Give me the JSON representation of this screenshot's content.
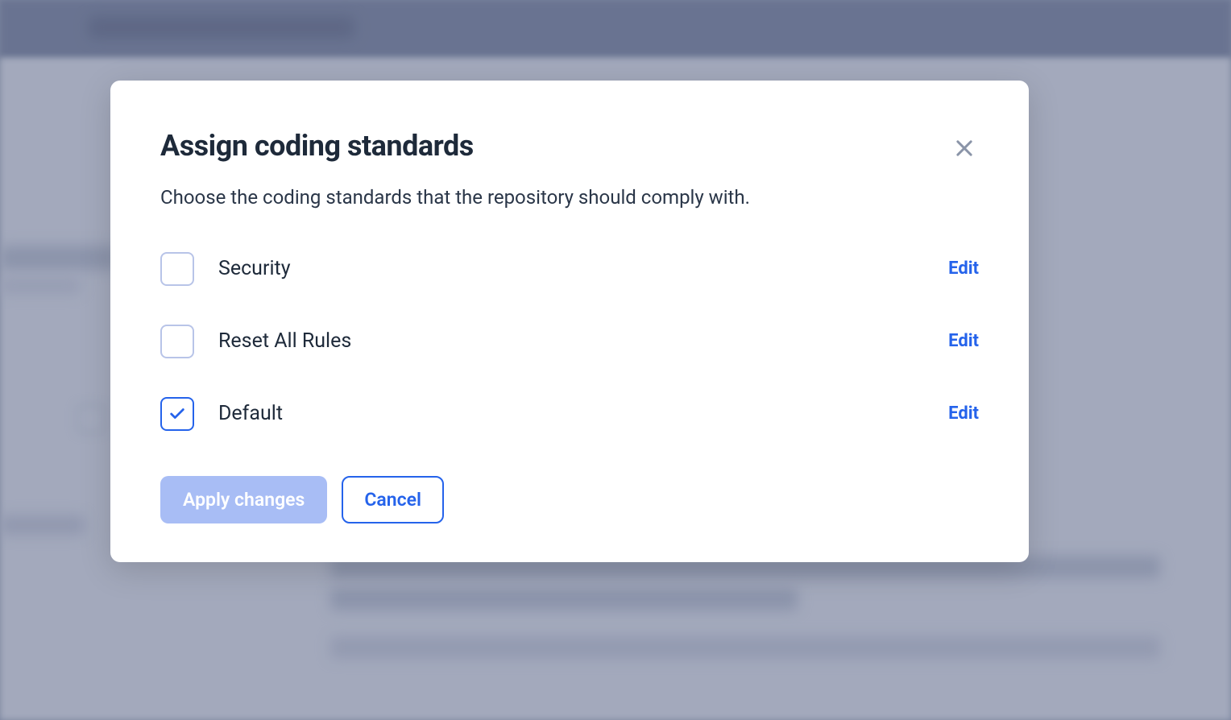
{
  "modal": {
    "title": "Assign coding standards",
    "description": "Choose the coding standards that the repository should comply with.",
    "standards": [
      {
        "label": "Security",
        "checked": false,
        "editLabel": "Edit"
      },
      {
        "label": "Reset All Rules",
        "checked": false,
        "editLabel": "Edit"
      },
      {
        "label": "Default",
        "checked": true,
        "editLabel": "Edit"
      }
    ],
    "actions": {
      "apply": "Apply changes",
      "cancel": "Cancel"
    }
  }
}
